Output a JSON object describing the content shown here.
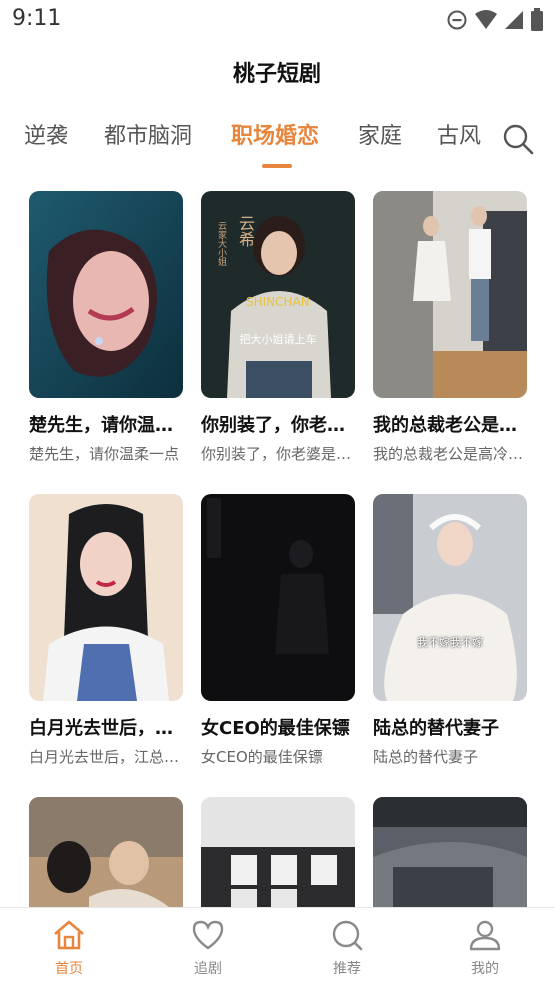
{
  "status_bar": {
    "time": "9:11",
    "icons": [
      "do-not-disturb-icon",
      "wifi-icon",
      "signal-icon",
      "battery-icon"
    ]
  },
  "app": {
    "title": "桃子短剧"
  },
  "tabs": [
    {
      "label": "逆袭",
      "active": false
    },
    {
      "label": "都市脑洞",
      "active": false
    },
    {
      "label": "职场婚恋",
      "active": true
    },
    {
      "label": "家庭",
      "active": false
    },
    {
      "label": "古风",
      "active": false
    }
  ],
  "search": {
    "icon": "search-icon"
  },
  "dramas": [
    {
      "title": "楚先生，请你温柔一点",
      "subtitle": "楚先生，请你温柔一点",
      "overlay_text": ""
    },
    {
      "title": "你别装了，你老婆是大小姐",
      "subtitle": "你别装了，你老婆是大小姐",
      "overlay_text": "把大小姐请上车",
      "poster_text": "云希",
      "poster_subtext": "云家大小姐"
    },
    {
      "title": "我的总裁老公是高冷男神",
      "subtitle": "我的总裁老公是高冷男神",
      "overlay_text": ""
    },
    {
      "title": "白月光去世后，江总后悔了",
      "subtitle": "白月光去世后，江总后悔了",
      "overlay_text": ""
    },
    {
      "title": "女CEO的最佳保镖",
      "subtitle": "女CEO的最佳保镖",
      "overlay_text": ""
    },
    {
      "title": "陆总的替代妻子",
      "subtitle": "陆总的替代妻子",
      "overlay_text": "我不嫁我不嫁"
    },
    {
      "title": "",
      "subtitle": "",
      "overlay_text": ""
    },
    {
      "title": "",
      "subtitle": "",
      "overlay_text": ""
    },
    {
      "title": "",
      "subtitle": "",
      "overlay_text": ""
    }
  ],
  "bottom_nav": [
    {
      "label": "首页",
      "icon": "home-icon",
      "active": true
    },
    {
      "label": "追剧",
      "icon": "heart-icon",
      "active": false
    },
    {
      "label": "推荐",
      "icon": "search-icon",
      "active": false
    },
    {
      "label": "我的",
      "icon": "user-icon",
      "active": false
    }
  ],
  "colors": {
    "accent": "#e8853c",
    "text": "#111111",
    "subtext": "#666666",
    "nav_inactive": "#888888"
  }
}
